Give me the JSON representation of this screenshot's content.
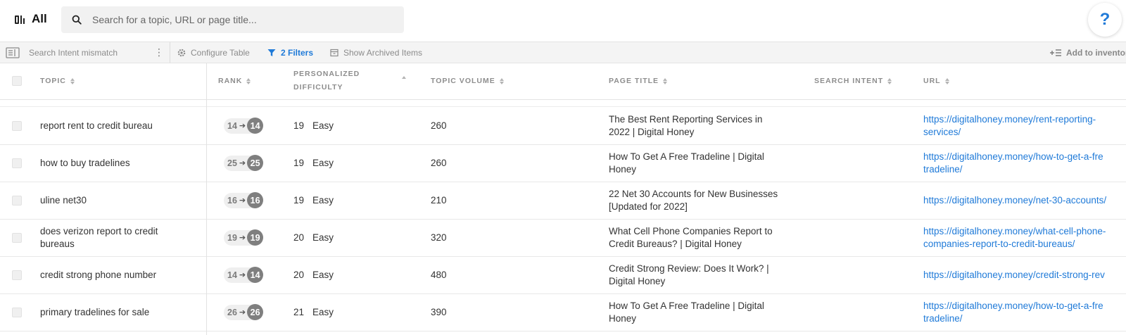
{
  "header": {
    "title": "All",
    "search_placeholder": "Search for a topic, URL or page title...",
    "help_label": "?"
  },
  "toolbar": {
    "view_name": "Search Intent mismatch",
    "configure": "Configure Table",
    "filters": "2 Filters",
    "archived": "Show Archived Items",
    "add_inventory": "Add to inventor"
  },
  "table": {
    "columns": {
      "topic": "TOPIC",
      "rank": "RANK",
      "difficulty_1": "PERSONALIZED",
      "difficulty_2": "DIFFICULTY",
      "volume": "TOPIC VOLUME",
      "page_title": "PAGE TITLE",
      "intent": "SEARCH INTENT",
      "url": "URL"
    },
    "rows": [
      {
        "topic_1": "report rent to credit bureau",
        "topic_2": "",
        "rank_from": "14",
        "rank_to": "14",
        "difficulty": "19",
        "difficulty_label": "Easy",
        "volume": "260",
        "title_1": "The Best Rent Reporting Services in",
        "title_2": "2022 | Digital Honey",
        "url_1": "https://digitalhoney.money/rent-reporting-",
        "url_2": "services/"
      },
      {
        "topic_1": "how to buy tradelines",
        "topic_2": "",
        "rank_from": "25",
        "rank_to": "25",
        "difficulty": "19",
        "difficulty_label": "Easy",
        "volume": "260",
        "title_1": "How To Get A Free Tradeline | Digital",
        "title_2": "Honey",
        "url_1": "https://digitalhoney.money/how-to-get-a-fre",
        "url_2": "tradeline/"
      },
      {
        "topic_1": "uline net30",
        "topic_2": "",
        "rank_from": "16",
        "rank_to": "16",
        "difficulty": "19",
        "difficulty_label": "Easy",
        "volume": "210",
        "title_1": "22 Net 30 Accounts for New Businesses",
        "title_2": "[Updated for 2022]",
        "url_1": "https://digitalhoney.money/net-30-accounts/",
        "url_2": ""
      },
      {
        "topic_1": "does verizon report to credit",
        "topic_2": "bureaus",
        "rank_from": "19",
        "rank_to": "19",
        "difficulty": "20",
        "difficulty_label": "Easy",
        "volume": "320",
        "title_1": "What Cell Phone Companies Report to",
        "title_2": "Credit Bureaus? | Digital Honey",
        "url_1": "https://digitalhoney.money/what-cell-phone-",
        "url_2": "companies-report-to-credit-bureaus/"
      },
      {
        "topic_1": "credit strong phone number",
        "topic_2": "",
        "rank_from": "14",
        "rank_to": "14",
        "difficulty": "20",
        "difficulty_label": "Easy",
        "volume": "480",
        "title_1": "Credit Strong Review: Does It Work? |",
        "title_2": "Digital Honey",
        "url_1": "https://digitalhoney.money/credit-strong-rev",
        "url_2": ""
      },
      {
        "topic_1": "primary tradelines for sale",
        "topic_2": "",
        "rank_from": "26",
        "rank_to": "26",
        "difficulty": "21",
        "difficulty_label": "Easy",
        "volume": "390",
        "title_1": "How To Get A Free Tradeline | Digital",
        "title_2": "Honey",
        "url_1": "https://digitalhoney.money/how-to-get-a-fre",
        "url_2": "tradeline/"
      }
    ]
  }
}
